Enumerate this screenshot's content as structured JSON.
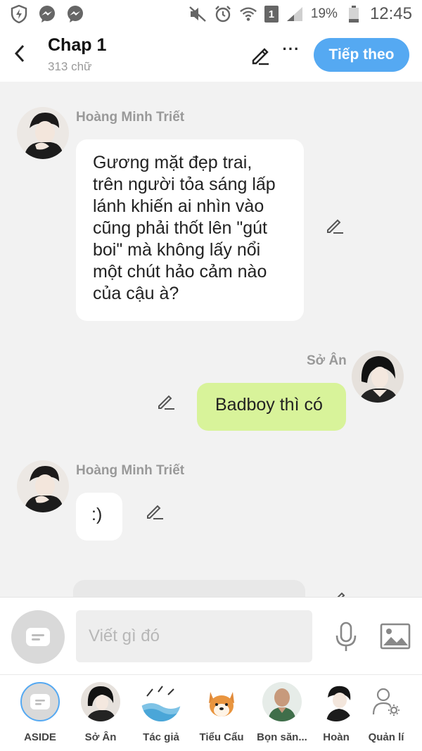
{
  "status_bar": {
    "battery": "19%",
    "time": "12:45",
    "sim": "1",
    "icons": [
      "shield-icon",
      "messenger-icon",
      "messenger-icon",
      "mute-icon",
      "alarm-icon",
      "wifi-icon",
      "signal-icon",
      "battery-icon"
    ]
  },
  "header": {
    "title": "Chap 1",
    "subtitle": "313 chữ",
    "next_label": "Tiếp theo",
    "more_label": "···"
  },
  "messages": [
    {
      "sender": "Hoàng Minh Triết",
      "text": "Gương mặt đẹp trai, trên người tỏa sáng lấp lánh khiến ai nhìn vào cũng phải thốt lên \"gút boi\" mà không lấy nổi một chút hảo cảm nào của cậu à?"
    },
    {
      "sender": "Sở Ân",
      "text": "Badboy thì có"
    },
    {
      "sender": "Hoàng Minh Triết",
      "text": ":)"
    }
  ],
  "composer": {
    "placeholder": "Viết gì đó"
  },
  "characters": [
    {
      "label": "ASIDE"
    },
    {
      "label": "Sở Ân"
    },
    {
      "label": "Tác giả"
    },
    {
      "label": "Tiểu Cẩu"
    },
    {
      "label": "Bọn săn..."
    },
    {
      "label": "Hoàn"
    },
    {
      "label": "Quản lí"
    }
  ],
  "colors": {
    "accent": "#55a9f2",
    "bubble_right": "#d8f39a",
    "bubble_left": "#ffffff",
    "chat_bg": "#f2f2f2"
  }
}
